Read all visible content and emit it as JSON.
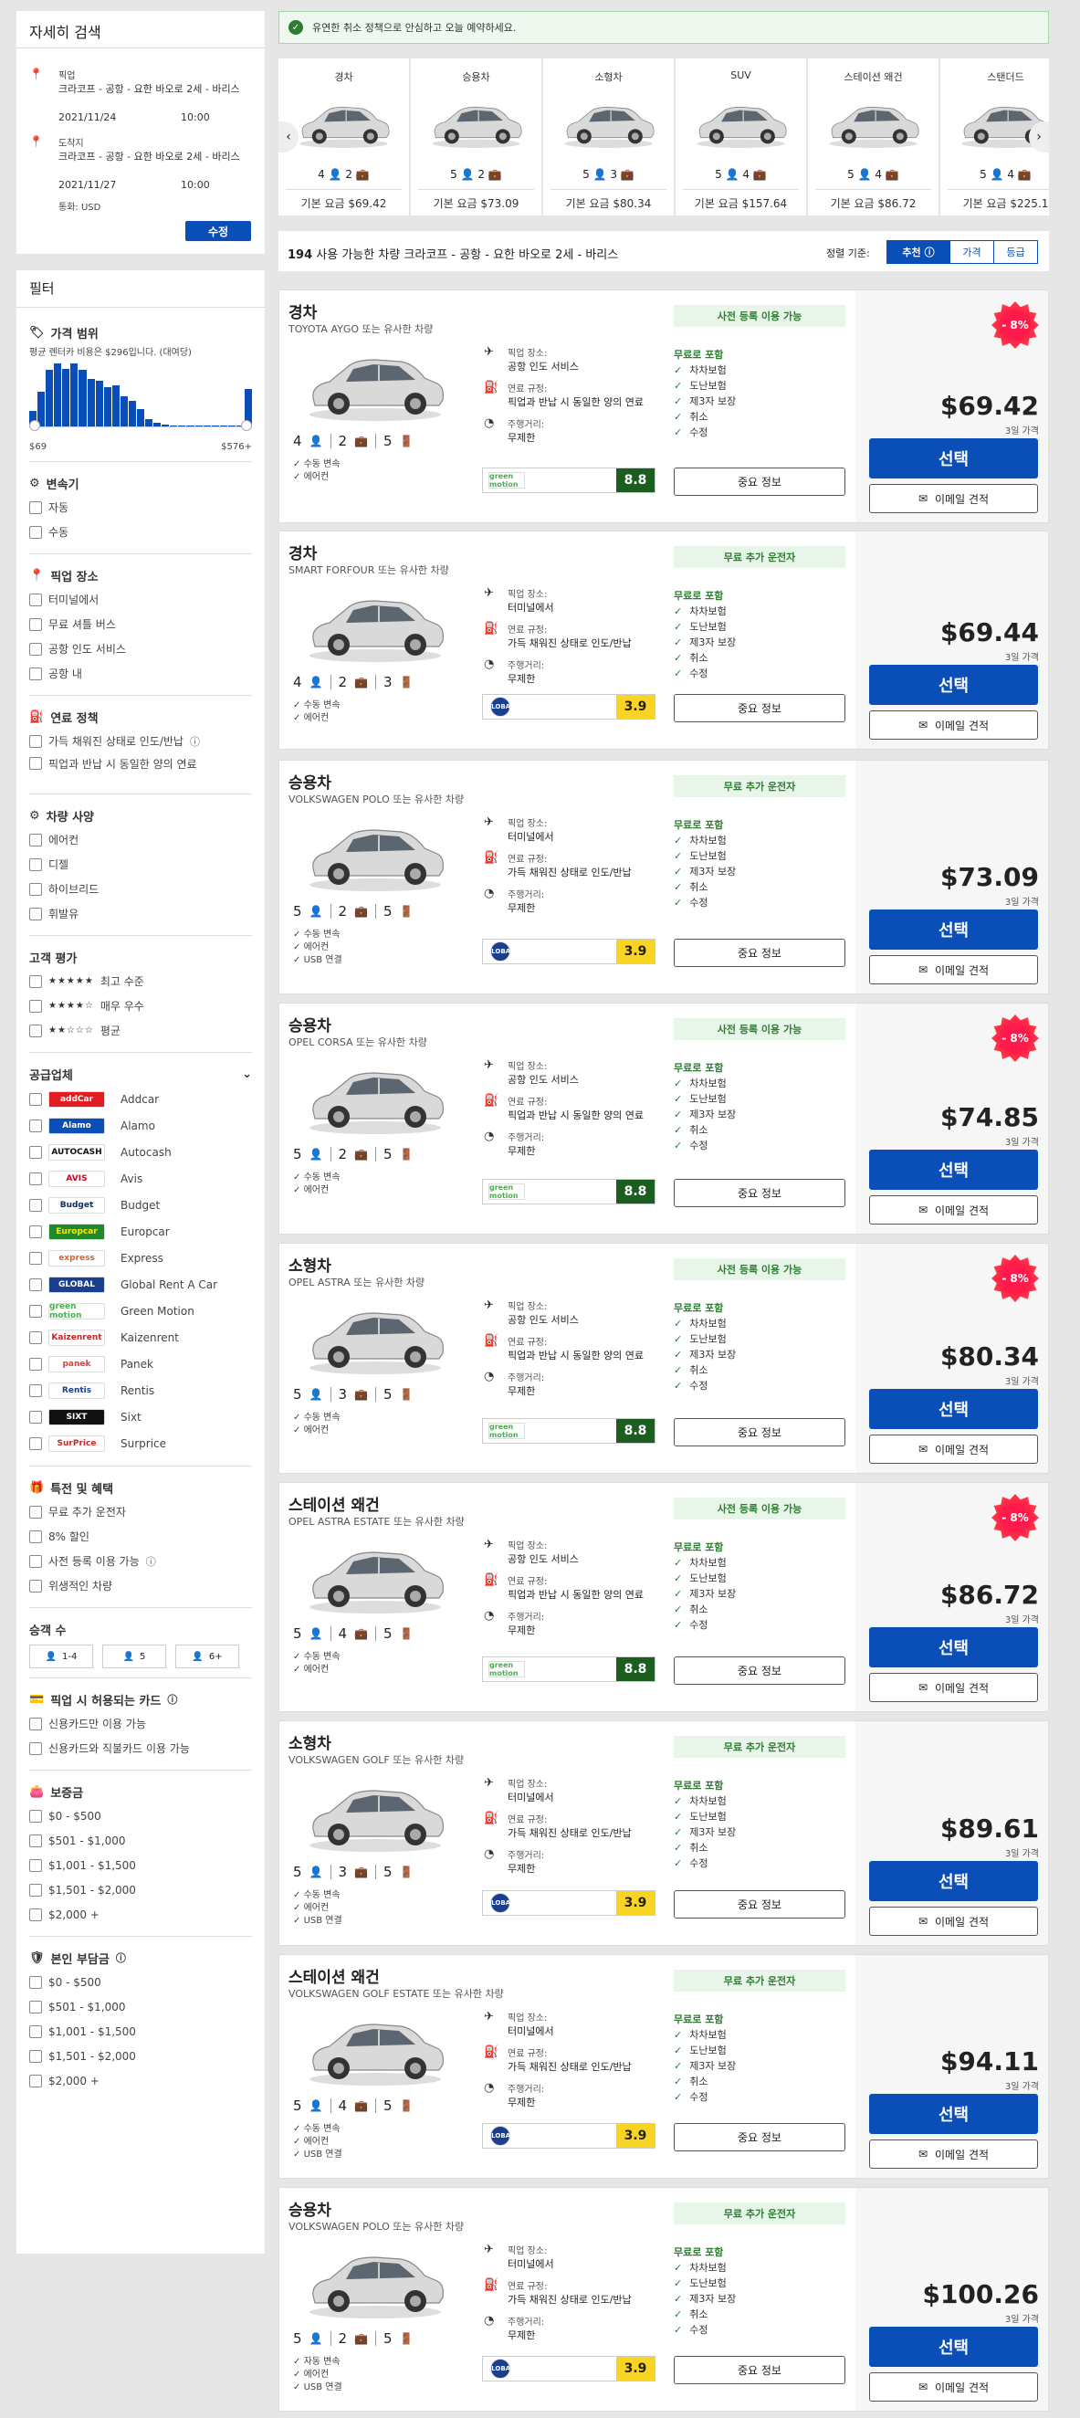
{
  "search": {
    "title": "자세히 검색",
    "pickup_label": "픽업",
    "pickup_location": "크라코프 - 공항 - 요한 바오로 2세 - 바리스",
    "pickup_date": "2021/11/24",
    "pickup_time": "10:00",
    "dropoff_label": "도착지",
    "dropoff_location": "크라코프 - 공항 - 요한 바오로 2세 - 바리스",
    "dropoff_date": "2021/11/27",
    "dropoff_time": "10:00",
    "currency": "통화: USD",
    "edit_button": "수정"
  },
  "notice": "유연한 취소 정책으로 안심하고 오늘 예약하세요.",
  "filters": {
    "title": "필터",
    "price": {
      "title": "가격 범위",
      "desc": "평균 렌터카 비용은 $296입니다. (대여당)",
      "min": "$69",
      "max": "$576+",
      "histogram": [
        0.25,
        0.55,
        0.9,
        1.0,
        0.92,
        1.0,
        0.9,
        0.75,
        0.72,
        0.62,
        0.65,
        0.48,
        0.4,
        0.28,
        0.12,
        0.06,
        0.03,
        0.02,
        0.02,
        0.02,
        0.02,
        0.02,
        0.02,
        0.02,
        0.02,
        0.02,
        0.6
      ]
    },
    "transmission": {
      "title": "변속기",
      "options": [
        "자동",
        "수동"
      ]
    },
    "pickup": {
      "title": "픽업 장소",
      "options": [
        "터미널에서",
        "무료 셔틀 버스",
        "공항 인도 서비스",
        "공항 내"
      ]
    },
    "fuel": {
      "title": "연료 정책",
      "options": [
        "가득 채워진 상태로 인도/반납",
        "픽업과 반납 시 동일한 양의 연료"
      ]
    },
    "specs": {
      "title": "차량 사양",
      "options": [
        "에어컨",
        "디젤",
        "하이브리드",
        "휘발유"
      ]
    },
    "rating": {
      "title": "고객 평가",
      "options": [
        {
          "stars": "★★★★★",
          "label": "최고 수준"
        },
        {
          "stars": "★★★★☆",
          "label": "매우 우수"
        },
        {
          "stars": "★★☆☆☆",
          "label": "평균"
        }
      ]
    },
    "suppliers": {
      "title": "공급업체",
      "options": [
        {
          "name": "Addcar",
          "logo": "addCar",
          "bg": "#e31b23",
          "fg": "#ffffff"
        },
        {
          "name": "Alamo",
          "logo": "Alamo",
          "bg": "#0a4eb8",
          "fg": "#ffffff"
        },
        {
          "name": "Autocash",
          "logo": "AUTOCASH",
          "bg": "#ffffff",
          "fg": "#111111"
        },
        {
          "name": "Avis",
          "logo": "AVIS",
          "bg": "#ffffff",
          "fg": "#d2001e"
        },
        {
          "name": "Budget",
          "logo": "Budget",
          "bg": "#ffffff",
          "fg": "#0a2f6b"
        },
        {
          "name": "Europcar",
          "logo": "Europcar",
          "bg": "#1e8a2e",
          "fg": "#ffe600"
        },
        {
          "name": "Express",
          "logo": "express",
          "bg": "#ffffff",
          "fg": "#e0622a"
        },
        {
          "name": "Global Rent A Car",
          "logo": "GLOBAL",
          "bg": "#1a3f8f",
          "fg": "#ffffff"
        },
        {
          "name": "Green Motion",
          "logo": "green motion",
          "bg": "#ffffff",
          "fg": "#4caf50"
        },
        {
          "name": "Kaizenrent",
          "logo": "Kaizenrent",
          "bg": "#ffffff",
          "fg": "#c62828"
        },
        {
          "name": "Panek",
          "logo": "panek",
          "bg": "#ffffff",
          "fg": "#e53935"
        },
        {
          "name": "Rentis",
          "logo": "Rentis",
          "bg": "#ffffff",
          "fg": "#1a3f8f"
        },
        {
          "name": "Sixt",
          "logo": "SIXT",
          "bg": "#111111",
          "fg": "#ffffff"
        },
        {
          "name": "Surprice",
          "logo": "SurPrice",
          "bg": "#ffffff",
          "fg": "#c62828"
        }
      ]
    },
    "perks": {
      "title": "특전 및 혜택",
      "options": [
        "무료 추가 운전자",
        "8% 할인",
        "사전 등록 이용 가능",
        "위생적인 차량"
      ]
    },
    "passengers": {
      "title": "승객 수",
      "options": [
        "1-4",
        "5",
        "6+"
      ]
    },
    "cards": {
      "title": "픽업 시 허용되는 카드",
      "options": [
        "신용카드만 이용 가능",
        "신용카드와 직불카드 이용 가능"
      ]
    },
    "deposit": {
      "title": "보증금",
      "options": [
        "$0 - $500",
        "$501 - $1,000",
        "$1,001 - $1,500",
        "$1,501 - $2,000",
        "$2,000 +"
      ]
    },
    "excess": {
      "title": "본인 부담금",
      "options": [
        "$0 - $500",
        "$501 - $1,000",
        "$1,001 - $1,500",
        "$1,501 - $2,000",
        "$2,000 +"
      ]
    }
  },
  "categories": [
    {
      "name": "경차",
      "pax": "4",
      "bags": "2",
      "price": "기본 요금 $69.42"
    },
    {
      "name": "승용차",
      "pax": "5",
      "bags": "2",
      "price": "기본 요금 $73.09"
    },
    {
      "name": "소형차",
      "pax": "5",
      "bags": "3",
      "price": "기본 요금 $80.34"
    },
    {
      "name": "SUV",
      "pax": "5",
      "bags": "4",
      "price": "기본 요금 $157.64"
    },
    {
      "name": "스테이션 왜건",
      "pax": "5",
      "bags": "4",
      "price": "기본 요금 $86.72"
    },
    {
      "name": "스탠더드",
      "pax": "5",
      "bags": "4",
      "price": "기본 요금 $225.1"
    }
  ],
  "results": {
    "count": "194",
    "text": "사용 가능한 차량 크라코프 - 공항 - 요한 바오로 2세 - 바리스",
    "sort_label": "정렬 기준:",
    "sort_options": [
      "추천",
      "가격",
      "등급"
    ]
  },
  "labels": {
    "pickup": "픽업 장소:",
    "fuel": "연료 규정:",
    "mileage": "주행거리:",
    "mileage_value": "무제한",
    "included": "무료로 포함",
    "incl_items": [
      "차차보험",
      "도난보험",
      "제3자 보장",
      "취소",
      "수정"
    ],
    "important": "중요 정보",
    "select": "선택",
    "email": "이메일 견적",
    "days": "3일 가격"
  },
  "cars": [
    {
      "cat": "경차",
      "model": "TOYOTA AYGO 또는 유사한 차량",
      "pax": "4",
      "bags": "2",
      "doors": "5",
      "feats": [
        "수동 변속",
        "에어컨"
      ],
      "pickup": "공항 인도 서비스",
      "fuel": "픽업과 반납 시 동일한 양의 연료",
      "tag": "사전 등록 이용 가능",
      "supplier": "green motion",
      "score": "8.8",
      "price": "$69.42",
      "badge": "- 8%"
    },
    {
      "cat": "경차",
      "model": "SMART FORFOUR 또는 유사한 차량",
      "pax": "4",
      "bags": "2",
      "doors": "3",
      "feats": [
        "수동 변속",
        "에어컨"
      ],
      "pickup": "터미널에서",
      "fuel": "가득 채워진 상태로 인도/반납",
      "tag": "무료 추가 운전자",
      "supplier": "GLOBAL",
      "score": "3.9",
      "price": "$69.44",
      "badge": ""
    },
    {
      "cat": "승용차",
      "model": "VOLKSWAGEN POLO 또는 유사한 차량",
      "pax": "5",
      "bags": "2",
      "doors": "5",
      "feats": [
        "수동 변속",
        "에어컨",
        "USB 연결"
      ],
      "pickup": "터미널에서",
      "fuel": "가득 채워진 상태로 인도/반납",
      "tag": "무료 추가 운전자",
      "supplier": "GLOBAL",
      "score": "3.9",
      "price": "$73.09",
      "badge": ""
    },
    {
      "cat": "승용차",
      "model": "OPEL CORSA 또는 유사한 차량",
      "pax": "5",
      "bags": "2",
      "doors": "5",
      "feats": [
        "수동 변속",
        "에어컨"
      ],
      "pickup": "공항 인도 서비스",
      "fuel": "픽업과 반납 시 동일한 양의 연료",
      "tag": "사전 등록 이용 가능",
      "supplier": "green motion",
      "score": "8.8",
      "price": "$74.85",
      "badge": "- 8%"
    },
    {
      "cat": "소형차",
      "model": "OPEL ASTRA 또는 유사한 차량",
      "pax": "5",
      "bags": "3",
      "doors": "5",
      "feats": [
        "수동 변속",
        "에어컨"
      ],
      "pickup": "공항 인도 서비스",
      "fuel": "픽업과 반납 시 동일한 양의 연료",
      "tag": "사전 등록 이용 가능",
      "supplier": "green motion",
      "score": "8.8",
      "price": "$80.34",
      "badge": "- 8%"
    },
    {
      "cat": "스테이션 왜건",
      "model": "OPEL ASTRA ESTATE 또는 유사한 차량",
      "pax": "5",
      "bags": "4",
      "doors": "5",
      "feats": [
        "수동 변속",
        "에어컨"
      ],
      "pickup": "공항 인도 서비스",
      "fuel": "픽업과 반납 시 동일한 양의 연료",
      "tag": "사전 등록 이용 가능",
      "supplier": "green motion",
      "score": "8.8",
      "price": "$86.72",
      "badge": "- 8%"
    },
    {
      "cat": "소형차",
      "model": "VOLKSWAGEN GOLF 또는 유사한 차량",
      "pax": "5",
      "bags": "3",
      "doors": "5",
      "feats": [
        "수동 변속",
        "에어컨",
        "USB 연결"
      ],
      "pickup": "터미널에서",
      "fuel": "가득 채워진 상태로 인도/반납",
      "tag": "무료 추가 운전자",
      "supplier": "GLOBAL",
      "score": "3.9",
      "price": "$89.61",
      "badge": ""
    },
    {
      "cat": "스테이션 왜건",
      "model": "VOLKSWAGEN GOLF ESTATE 또는 유사한 차량",
      "pax": "5",
      "bags": "4",
      "doors": "5",
      "feats": [
        "수동 변속",
        "에어컨",
        "USB 연결"
      ],
      "pickup": "터미널에서",
      "fuel": "가득 채워진 상태로 인도/반납",
      "tag": "무료 추가 운전자",
      "supplier": "GLOBAL",
      "score": "3.9",
      "price": "$94.11",
      "badge": ""
    },
    {
      "cat": "승용차",
      "model": "VOLKSWAGEN POLO 또는 유사한 차량",
      "pax": "5",
      "bags": "2",
      "doors": "5",
      "feats": [
        "자동 변속",
        "에어컨",
        "USB 연결"
      ],
      "pickup": "터미널에서",
      "fuel": "가득 채워진 상태로 인도/반납",
      "tag": "무료 추가 운전자",
      "supplier": "GLOBAL",
      "score": "3.9",
      "price": "$100.26",
      "badge": ""
    }
  ],
  "colors": {
    "brand_blue": "#0a4eb8",
    "green": "#2e7d32",
    "score_high": "#1b5e20",
    "score_mid": "#f9d423",
    "badge": "#ff1a4b"
  }
}
